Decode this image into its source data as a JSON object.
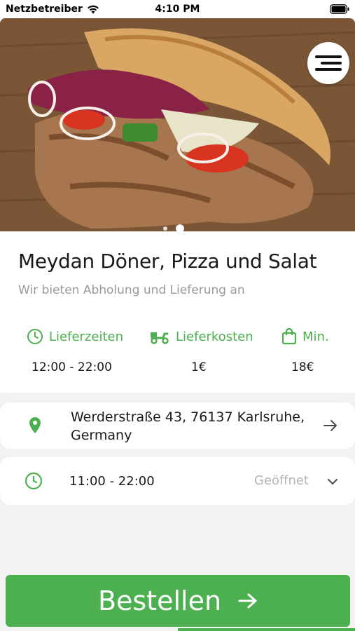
{
  "status_bar": {
    "carrier": "Netzbetreiber",
    "time": "4:10 PM"
  },
  "hero": {
    "page_count": 2,
    "active_page": 2
  },
  "restaurant": {
    "name": "Meydan Döner, Pizza und Salat",
    "tagline": "Wir bieten Abholung und Lieferung an"
  },
  "stats": {
    "delivery_times": {
      "label": "Lieferzeiten",
      "value": "12:00 - 22:00",
      "icon": "clock-icon"
    },
    "delivery_cost": {
      "label": "Lieferkosten",
      "value": "1€",
      "icon": "scooter-icon"
    },
    "minimum": {
      "label": "Min.",
      "value": "18€",
      "icon": "shopping-bag-icon"
    }
  },
  "address": {
    "text": "Werderstraße 43, 76137 Karlsruhe, Germany",
    "icon": "location-pin-icon"
  },
  "hours": {
    "text": "11:00 - 22:00",
    "status": "Geöffnet",
    "icon": "clock-icon"
  },
  "order_button": {
    "label": "Bestellen"
  },
  "colors": {
    "accent": "#4caf50",
    "muted": "#9a9a9a",
    "background": "#f2f2f2"
  }
}
